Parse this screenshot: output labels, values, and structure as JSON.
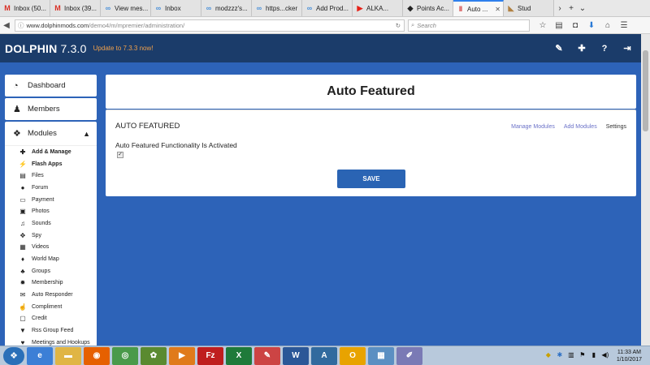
{
  "browser": {
    "tabs": [
      {
        "label": "Inbox (50...",
        "icon": "gmail-icon",
        "icon_glyph": "M",
        "icon_color": "#d93025"
      },
      {
        "label": "Inbox (39...",
        "icon": "gmail-icon",
        "icon_glyph": "M",
        "icon_color": "#d93025"
      },
      {
        "label": "View mes...",
        "icon": "link-icon",
        "icon_glyph": "∞",
        "icon_color": "#4a90d9"
      },
      {
        "label": "Inbox",
        "icon": "link-icon",
        "icon_glyph": "∞",
        "icon_color": "#4a90d9"
      },
      {
        "label": "modzzz's...",
        "icon": "link-icon",
        "icon_glyph": "∞",
        "icon_color": "#4a90d9"
      },
      {
        "label": "https...cker",
        "icon": "link-icon",
        "icon_glyph": "∞",
        "icon_color": "#4a90d9"
      },
      {
        "label": "Add Prod...",
        "icon": "link-icon",
        "icon_glyph": "∞",
        "icon_color": "#4a90d9"
      },
      {
        "label": "ALKA...",
        "icon": "youtube-icon",
        "icon_glyph": "▶",
        "icon_color": "#e62117"
      },
      {
        "label": "Points Ac...",
        "icon": "site-icon",
        "icon_glyph": "◆",
        "icon_color": "#222222"
      },
      {
        "label": "Auto ...",
        "icon": "dolphin-icon",
        "icon_glyph": "‖",
        "icon_color": "#cc2222",
        "active": true
      },
      {
        "label": "Stud",
        "icon": "site-icon",
        "icon_glyph": "◣",
        "icon_color": "#b08040"
      }
    ],
    "url_domain": "www.dolphinmods.com",
    "url_path": "/demo4/m/mpremier/administration/",
    "search_placeholder": "Search"
  },
  "header": {
    "logo": "DOLPHIN",
    "version": "7.3.0",
    "update_link": "Update to 7.3.3 now!"
  },
  "sidebar": {
    "dashboard": "Dashboard",
    "members": "Members",
    "modules": "Modules",
    "items": [
      {
        "label": "Add & Manage",
        "icon": "plus-icon",
        "glyph": "✚",
        "bold": true
      },
      {
        "label": "Flash Apps",
        "icon": "bolt-icon",
        "glyph": "⚡",
        "bold": true
      },
      {
        "label": "Files",
        "icon": "file-icon",
        "glyph": "▤"
      },
      {
        "label": "Forum",
        "icon": "chat-icon",
        "glyph": "●"
      },
      {
        "label": "Payment",
        "icon": "card-icon",
        "glyph": "▭"
      },
      {
        "label": "Photos",
        "icon": "photo-icon",
        "glyph": "▣"
      },
      {
        "label": "Sounds",
        "icon": "music-icon",
        "glyph": "♫"
      },
      {
        "label": "Spy",
        "icon": "crosshair-icon",
        "glyph": "✥"
      },
      {
        "label": "Videos",
        "icon": "video-icon",
        "glyph": "▦"
      },
      {
        "label": "World Map",
        "icon": "map-pin-icon",
        "glyph": "♦"
      },
      {
        "label": "Groups",
        "icon": "group-icon",
        "glyph": "♣"
      },
      {
        "label": "Membership",
        "icon": "gear-icon",
        "glyph": "✹"
      },
      {
        "label": "Auto Responder",
        "icon": "mail-icon",
        "glyph": "✉"
      },
      {
        "label": "Compliment",
        "icon": "thumbs-up-icon",
        "glyph": "☝"
      },
      {
        "label": "Credit",
        "icon": "credit-icon",
        "glyph": "▢"
      },
      {
        "label": "Rss Group Feed",
        "icon": "filter-icon",
        "glyph": "▼"
      },
      {
        "label": "Meetings and Hookups",
        "icon": "heart-icon",
        "glyph": "♥"
      }
    ]
  },
  "main": {
    "title": "Auto Featured",
    "section_title": "AUTO FEATURED",
    "links": {
      "manage": "Manage Modules",
      "add": "Add Modules",
      "settings": "Settings"
    },
    "field_label": "Auto Featured Functionality Is Activated",
    "checkbox_checked": true,
    "save_label": "SAVE"
  },
  "taskbar": {
    "apps": [
      {
        "name": "ie",
        "color": "#3c7fd6",
        "glyph": "e"
      },
      {
        "name": "explorer",
        "color": "#e0b544",
        "glyph": "▬"
      },
      {
        "name": "firefox",
        "color": "#e66000",
        "glyph": "◉"
      },
      {
        "name": "chrome",
        "color": "#4a9a4a",
        "glyph": "◎"
      },
      {
        "name": "frog",
        "color": "#5a8a30",
        "glyph": "✿"
      },
      {
        "name": "media",
        "color": "#e07a1a",
        "glyph": "▶"
      },
      {
        "name": "filezilla",
        "color": "#bf1e1e",
        "glyph": "Fz"
      },
      {
        "name": "excel",
        "color": "#1f7a3a",
        "glyph": "X"
      },
      {
        "name": "paint",
        "color": "#c44",
        "glyph": "✎"
      },
      {
        "name": "word",
        "color": "#2b5797",
        "glyph": "W"
      },
      {
        "name": "publisher",
        "color": "#316a9e",
        "glyph": "A"
      },
      {
        "name": "outlook",
        "color": "#e8a300",
        "glyph": "O"
      },
      {
        "name": "photos",
        "color": "#5b8fc2",
        "glyph": "▦"
      },
      {
        "name": "brush",
        "color": "#7a7ab5",
        "glyph": "✐"
      }
    ],
    "time": "11:33 AM",
    "date": "1/10/2017"
  }
}
